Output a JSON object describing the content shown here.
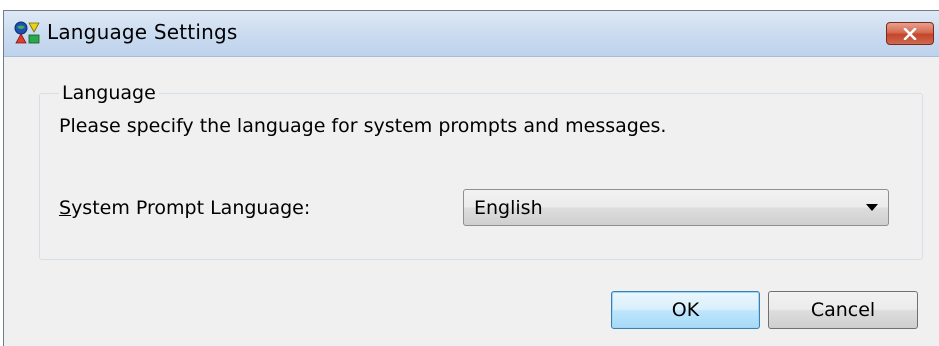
{
  "window": {
    "title": "Language Settings",
    "close_label": "close"
  },
  "group": {
    "legend": "Language",
    "description": "Please specify the language for system prompts and messages."
  },
  "prompt_language": {
    "label_mnemonic": "S",
    "label_rest": "ystem Prompt Language:",
    "selected": "English"
  },
  "buttons": {
    "ok": "OK",
    "cancel": "Cancel"
  },
  "icons": {
    "app": "language-app-icon",
    "close": "close-icon",
    "dropdown": "chevron-down-icon"
  },
  "colors": {
    "titlebar": "#cbdcf0",
    "close_button": "#c4452b",
    "dialog_background": "#f0f0f0",
    "default_button_border": "#3c7fb1"
  }
}
